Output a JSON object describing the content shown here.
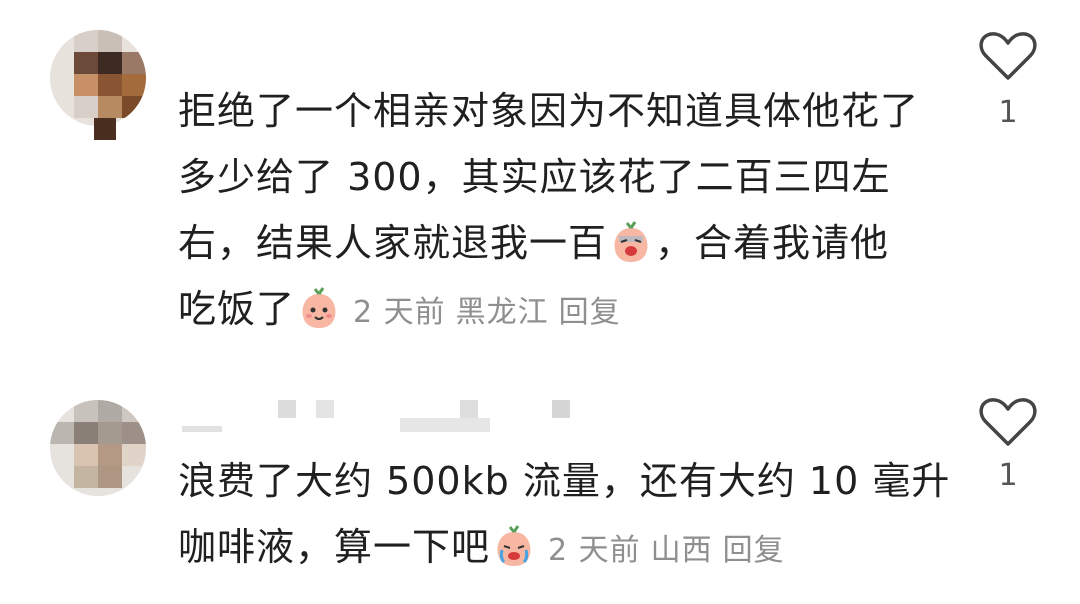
{
  "comments": [
    {
      "line1": "拒绝了一个相亲对象因为不知道具体他花了",
      "line2": "多少给了 300，其实应该花了二百三四左",
      "line3a": "右，结果人家就退我一百",
      "line3b": "，合着我请他",
      "line4": "吃饭了",
      "time": "2 天前",
      "location": "黑龙江",
      "reply": "回复",
      "likes": "1"
    },
    {
      "line1": "浪费了大约 500kb 流量，还有大约 10 毫升",
      "line2": "咖啡液，算一下吧",
      "time": "2 天前",
      "location": "山西",
      "reply": "回复",
      "likes": "1"
    }
  ],
  "icons": {
    "like": "heart-outline-icon",
    "emoji_smile": "peach-smile-emoji",
    "emoji_cry": "peach-crying-emoji",
    "emoji_shock": "peach-shock-emoji"
  }
}
